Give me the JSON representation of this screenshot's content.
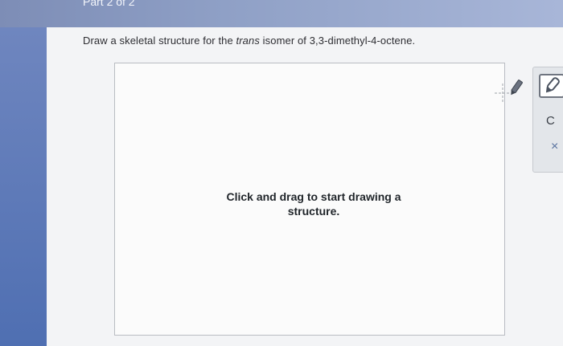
{
  "header": {
    "part_label": "Part 2 of 2"
  },
  "question": {
    "prefix": "Draw a skeletal structure for the ",
    "emphasis": "trans",
    "suffix": " isomer of 3,3-dimethyl-4-octene."
  },
  "canvas": {
    "hint_line1": "Click and drag to start drawing a",
    "hint_line2": "structure."
  },
  "toolbar": {
    "tools": [
      {
        "icon": "pencil-icon"
      },
      {
        "label": "C"
      },
      {
        "label": "×"
      }
    ]
  },
  "colors": {
    "header_bar": "#8fa0c6",
    "left_strip": "#5a76b8",
    "canvas_border": "#b9bcc2"
  }
}
